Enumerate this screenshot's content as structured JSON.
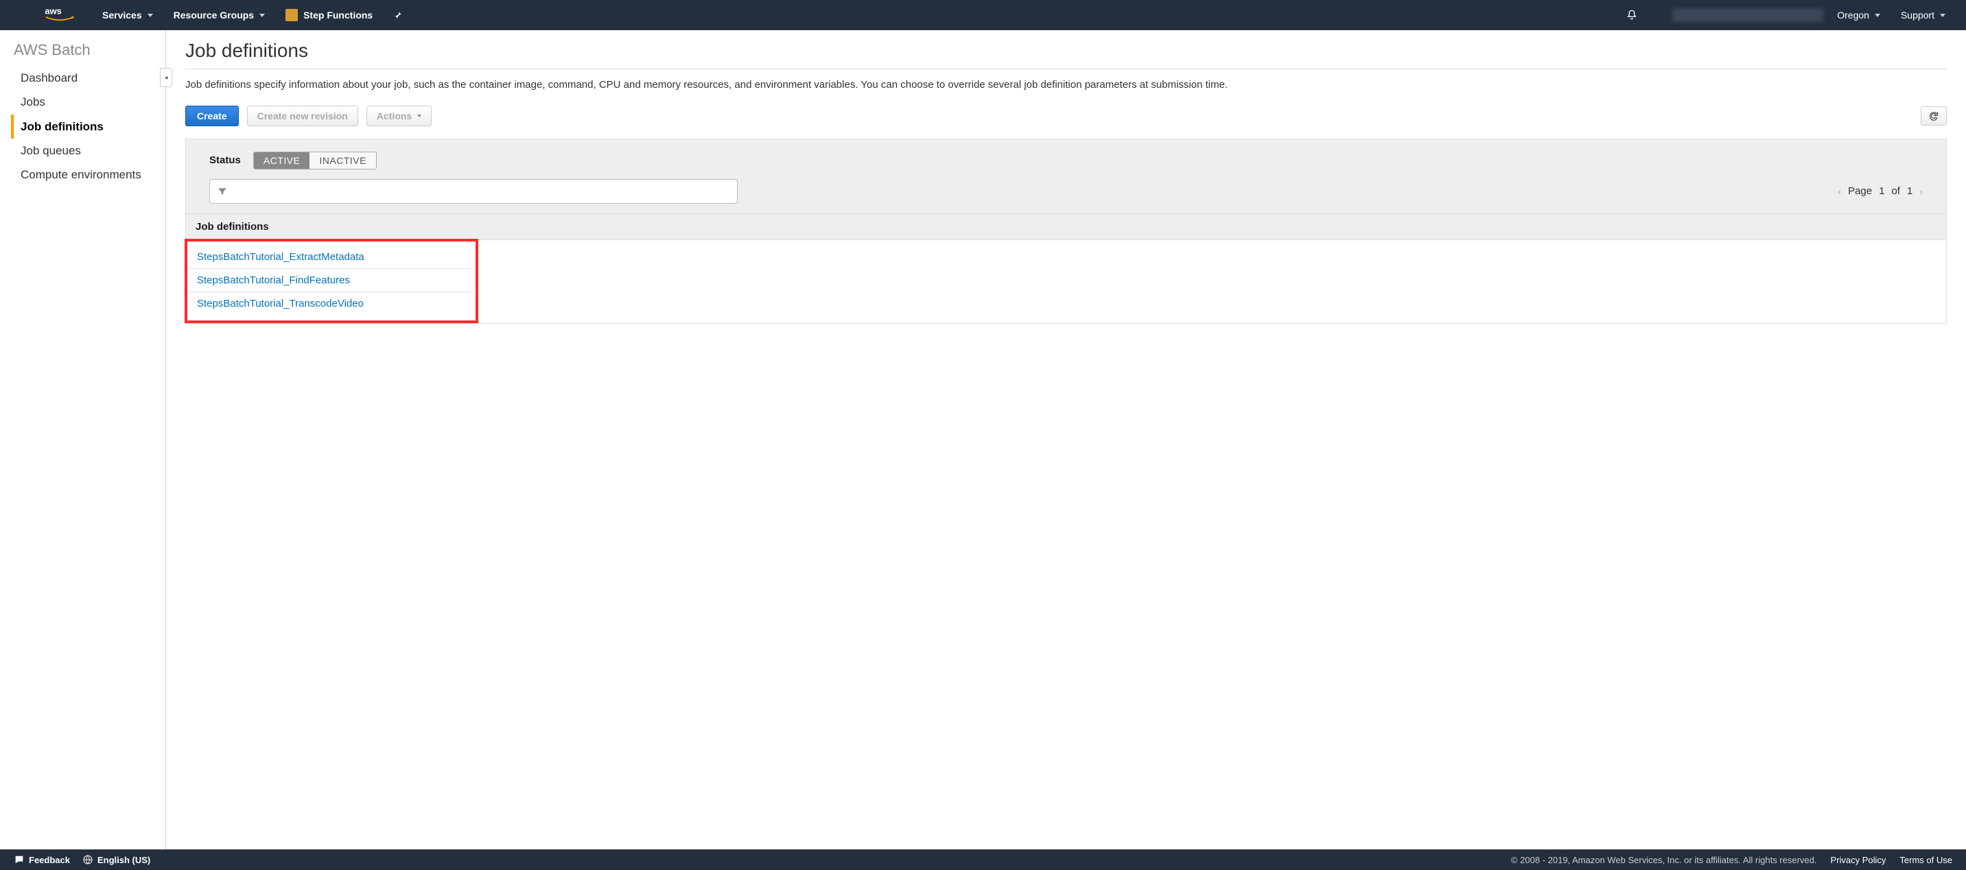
{
  "topnav": {
    "services": "Services",
    "resource_groups": "Resource Groups",
    "step_functions": "Step Functions",
    "region": "Oregon",
    "support": "Support"
  },
  "sidebar": {
    "title": "AWS Batch",
    "items": [
      {
        "label": "Dashboard"
      },
      {
        "label": "Jobs"
      },
      {
        "label": "Job definitions"
      },
      {
        "label": "Job queues"
      },
      {
        "label": "Compute environments"
      }
    ]
  },
  "page": {
    "title": "Job definitions",
    "description": "Job definitions specify information about your job, such as the container image, command, CPU and memory resources, and environment variables. You can choose to override several job definition parameters at submission time."
  },
  "toolbar": {
    "create": "Create",
    "new_rev": "Create new revision",
    "actions": "Actions"
  },
  "filter": {
    "status_label": "Status",
    "active": "ACTIVE",
    "inactive": "INACTIVE",
    "pager_prefix": "Page",
    "pager_page": "1",
    "pager_of": "of",
    "pager_total": "1"
  },
  "table": {
    "header": "Job definitions",
    "rows": [
      "StepsBatchTutorial_ExtractMetadata",
      "StepsBatchTutorial_FindFeatures",
      "StepsBatchTutorial_TranscodeVideo"
    ]
  },
  "footer": {
    "feedback": "Feedback",
    "language": "English (US)",
    "copyright": "© 2008 - 2019, Amazon Web Services, Inc. or its affiliates. All rights reserved.",
    "privacy": "Privacy Policy",
    "terms": "Terms of Use"
  }
}
